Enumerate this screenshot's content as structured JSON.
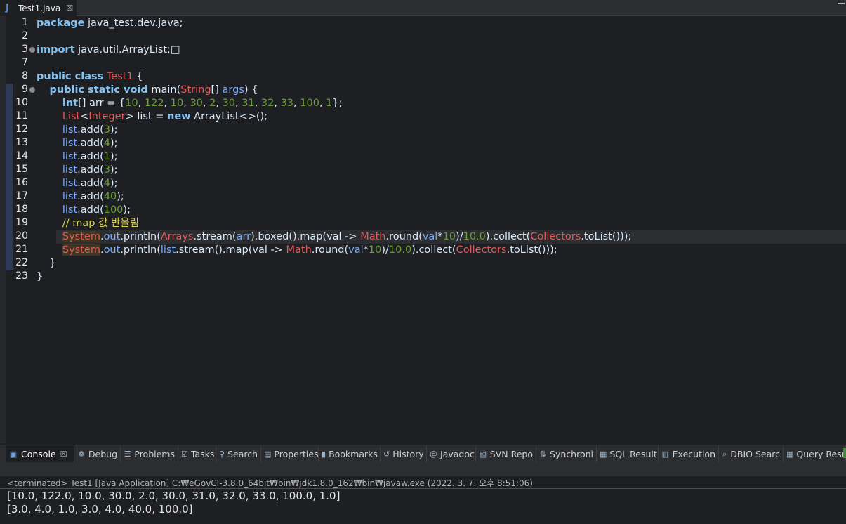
{
  "editor_tab": {
    "icon": "java-file-icon",
    "label": "Test1.java",
    "close": "☒"
  },
  "code": {
    "lines": [
      {
        "n": "1",
        "tokens": [
          {
            "t": "package",
            "c": "kwb"
          },
          {
            "t": " java_test.dev.java;",
            "c": "plain"
          }
        ]
      },
      {
        "n": "2",
        "tokens": []
      },
      {
        "n": "3",
        "tokens": [
          {
            "t": "import",
            "c": "kwb"
          },
          {
            "t": " java.util.ArrayList;",
            "c": "plain"
          },
          {
            "t": "□",
            "c": "plain"
          }
        ]
      },
      {
        "n": "7",
        "tokens": []
      },
      {
        "n": "8",
        "tokens": [
          {
            "t": "public class",
            "c": "kwb"
          },
          {
            "t": " ",
            "c": "plain"
          },
          {
            "t": "Test1",
            "c": "cls"
          },
          {
            "t": " {",
            "c": "plain"
          }
        ]
      },
      {
        "n": "9",
        "tokens": [
          {
            "t": "    ",
            "c": "plain"
          },
          {
            "t": "public static void",
            "c": "kwb"
          },
          {
            "t": " main(",
            "c": "plain"
          },
          {
            "t": "String",
            "c": "cls"
          },
          {
            "t": "[] ",
            "c": "plain"
          },
          {
            "t": "args",
            "c": "var"
          },
          {
            "t": ") {",
            "c": "plain"
          }
        ]
      },
      {
        "n": "10",
        "tokens": [
          {
            "t": "        ",
            "c": "plain"
          },
          {
            "t": "int",
            "c": "kwb"
          },
          {
            "t": "[] arr = {",
            "c": "plain"
          },
          {
            "t": "10",
            "c": "num"
          },
          {
            "t": ", ",
            "c": "plain"
          },
          {
            "t": "122",
            "c": "num"
          },
          {
            "t": ", ",
            "c": "plain"
          },
          {
            "t": "10",
            "c": "num"
          },
          {
            "t": ", ",
            "c": "plain"
          },
          {
            "t": "30",
            "c": "num"
          },
          {
            "t": ", ",
            "c": "plain"
          },
          {
            "t": "2",
            "c": "num"
          },
          {
            "t": ", ",
            "c": "plain"
          },
          {
            "t": "30",
            "c": "num"
          },
          {
            "t": ", ",
            "c": "plain"
          },
          {
            "t": "31",
            "c": "num"
          },
          {
            "t": ", ",
            "c": "plain"
          },
          {
            "t": "32",
            "c": "num"
          },
          {
            "t": ", ",
            "c": "plain"
          },
          {
            "t": "33",
            "c": "num"
          },
          {
            "t": ", ",
            "c": "plain"
          },
          {
            "t": "100",
            "c": "num"
          },
          {
            "t": ", ",
            "c": "plain"
          },
          {
            "t": "1",
            "c": "num"
          },
          {
            "t": "};",
            "c": "plain"
          }
        ]
      },
      {
        "n": "11",
        "tokens": [
          {
            "t": "        ",
            "c": "plain"
          },
          {
            "t": "List",
            "c": "cls"
          },
          {
            "t": "<",
            "c": "plain"
          },
          {
            "t": "Integer",
            "c": "cls"
          },
          {
            "t": "> list = ",
            "c": "plain"
          },
          {
            "t": "new",
            "c": "kwb"
          },
          {
            "t": " ArrayList<>();",
            "c": "plain"
          }
        ]
      },
      {
        "n": "12",
        "tokens": [
          {
            "t": "        ",
            "c": "plain"
          },
          {
            "t": "list",
            "c": "var"
          },
          {
            "t": ".add(",
            "c": "plain"
          },
          {
            "t": "3",
            "c": "num"
          },
          {
            "t": ");",
            "c": "plain"
          }
        ]
      },
      {
        "n": "13",
        "tokens": [
          {
            "t": "        ",
            "c": "plain"
          },
          {
            "t": "list",
            "c": "var"
          },
          {
            "t": ".add(",
            "c": "plain"
          },
          {
            "t": "4",
            "c": "num"
          },
          {
            "t": ");",
            "c": "plain"
          }
        ]
      },
      {
        "n": "14",
        "tokens": [
          {
            "t": "        ",
            "c": "plain"
          },
          {
            "t": "list",
            "c": "var"
          },
          {
            "t": ".add(",
            "c": "plain"
          },
          {
            "t": "1",
            "c": "num"
          },
          {
            "t": ");",
            "c": "plain"
          }
        ]
      },
      {
        "n": "15",
        "tokens": [
          {
            "t": "        ",
            "c": "plain"
          },
          {
            "t": "list",
            "c": "var"
          },
          {
            "t": ".add(",
            "c": "plain"
          },
          {
            "t": "3",
            "c": "num"
          },
          {
            "t": ");",
            "c": "plain"
          }
        ]
      },
      {
        "n": "16",
        "tokens": [
          {
            "t": "        ",
            "c": "plain"
          },
          {
            "t": "list",
            "c": "var"
          },
          {
            "t": ".add(",
            "c": "plain"
          },
          {
            "t": "4",
            "c": "num"
          },
          {
            "t": ");",
            "c": "plain"
          }
        ]
      },
      {
        "n": "17",
        "tokens": [
          {
            "t": "        ",
            "c": "plain"
          },
          {
            "t": "list",
            "c": "var"
          },
          {
            "t": ".add(",
            "c": "plain"
          },
          {
            "t": "40",
            "c": "num"
          },
          {
            "t": ");",
            "c": "plain"
          }
        ]
      },
      {
        "n": "18",
        "tokens": [
          {
            "t": "        ",
            "c": "plain"
          },
          {
            "t": "list",
            "c": "var"
          },
          {
            "t": ".add(",
            "c": "plain"
          },
          {
            "t": "100",
            "c": "num"
          },
          {
            "t": ");",
            "c": "plain"
          }
        ]
      },
      {
        "n": "19",
        "tokens": [
          {
            "t": "        ",
            "c": "plain"
          },
          {
            "t": "// map 값 반올림",
            "c": "cmt"
          }
        ]
      },
      {
        "n": "20",
        "tokens": [
          {
            "t": "        ",
            "c": "plain"
          },
          {
            "t": "System",
            "c": "sysbox"
          },
          {
            "t": ".",
            "c": "plain"
          },
          {
            "t": "out",
            "c": "var"
          },
          {
            "t": ".println(",
            "c": "plain"
          },
          {
            "t": "Arrays",
            "c": "cls"
          },
          {
            "t": ".stream(",
            "c": "plain"
          },
          {
            "t": "arr",
            "c": "var"
          },
          {
            "t": ").boxed().map(val -> ",
            "c": "plain"
          },
          {
            "t": "Math",
            "c": "cls"
          },
          {
            "t": ".round(",
            "c": "plain"
          },
          {
            "t": "val",
            "c": "var"
          },
          {
            "t": "*",
            "c": "plain"
          },
          {
            "t": "10",
            "c": "num"
          },
          {
            "t": ")/",
            "c": "plain"
          },
          {
            "t": "10.0",
            "c": "num"
          },
          {
            "t": ").collect(",
            "c": "plain"
          },
          {
            "t": "Collectors",
            "c": "cls"
          },
          {
            "t": ".toList()));",
            "c": "plain"
          }
        ]
      },
      {
        "n": "21",
        "tokens": [
          {
            "t": "        ",
            "c": "plain"
          },
          {
            "t": "System",
            "c": "sysbox"
          },
          {
            "t": ".",
            "c": "plain"
          },
          {
            "t": "out",
            "c": "var"
          },
          {
            "t": ".println(",
            "c": "plain"
          },
          {
            "t": "list",
            "c": "var"
          },
          {
            "t": ".stream().map(val -> ",
            "c": "plain"
          },
          {
            "t": "Math",
            "c": "cls"
          },
          {
            "t": ".round(",
            "c": "plain"
          },
          {
            "t": "val",
            "c": "var"
          },
          {
            "t": "*",
            "c": "plain"
          },
          {
            "t": "10",
            "c": "num"
          },
          {
            "t": ")/",
            "c": "plain"
          },
          {
            "t": "10.0",
            "c": "num"
          },
          {
            "t": ").collect(",
            "c": "plain"
          },
          {
            "t": "Collectors",
            "c": "cls"
          },
          {
            "t": ".toList()));",
            "c": "plain"
          }
        ]
      },
      {
        "n": "22",
        "tokens": [
          {
            "t": "    }",
            "c": "plain"
          }
        ]
      },
      {
        "n": "23",
        "tokens": [
          {
            "t": "}",
            "c": "plain"
          }
        ]
      }
    ]
  },
  "views": {
    "tabs": [
      {
        "label": "Console",
        "icon": "console-icon",
        "active": true,
        "close": "☒"
      },
      {
        "label": "Debug",
        "icon": "debug-bug-icon"
      },
      {
        "label": "Problems",
        "icon": "problems-icon"
      },
      {
        "label": "Tasks",
        "icon": "tasks-icon"
      },
      {
        "label": "Search",
        "icon": "search-icon"
      },
      {
        "label": "Properties",
        "icon": "properties-icon"
      },
      {
        "label": "Bookmarks",
        "icon": "bookmark-icon"
      },
      {
        "label": "History",
        "icon": "history-icon"
      },
      {
        "label": "Javadoc",
        "icon": "javadoc-icon"
      },
      {
        "label": "SVN Repo",
        "icon": "svn-repo-icon"
      },
      {
        "label": "Synchroni",
        "icon": "synchronize-icon"
      },
      {
        "label": "SQL Result",
        "icon": "sql-result-icon"
      },
      {
        "label": "Execution",
        "icon": "execution-plan-icon"
      },
      {
        "label": "DBIO Searc",
        "icon": "dbio-search-icon"
      },
      {
        "label": "Query Resu",
        "icon": "query-result-icon"
      }
    ]
  },
  "console": {
    "terminated": "<terminated> Test1 [Java Application] C:₩eGovCI-3.8.0_64bit₩bin₩jdk1.8.0_162₩bin₩javaw.exe (2022. 3. 7. 오후 8:51:06)",
    "output": [
      "[10.0, 122.0, 10.0, 30.0, 2.0, 30.0, 31.0, 32.0, 33.0, 100.0, 1.0]",
      "[3.0, 4.0, 1.0, 3.0, 4.0, 40.0, 100.0]"
    ]
  },
  "colors": {
    "editor_bg": "#1e1f22",
    "keyword": "#84c3f1",
    "class": "#e05a5a",
    "number": "#6a9e35",
    "variable": "#79abff",
    "comment": "#d9d24a"
  }
}
